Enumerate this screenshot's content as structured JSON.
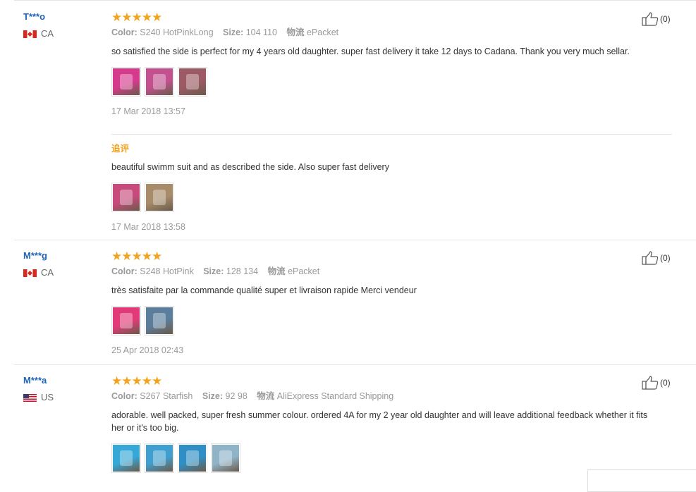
{
  "reviews": [
    {
      "user": "T***o",
      "country_code": "CA",
      "flag_icon": "canada-flag-icon",
      "rating": 5,
      "stars": "★★★★★",
      "color_label": "Color:",
      "color_value": "S240 HotPinkLong",
      "size_label": "Size:",
      "size_value": "104 110",
      "shipping_label": "物流",
      "shipping_value": "ePacket",
      "text": "so satisfied the side is perfect for my 4 years old daughter. super fast delivery it take 12 days to Cadana. Thank you very much sellar.",
      "thumbnails": [
        {
          "icon": "photo-thumbnail",
          "color": "#d63a8c"
        },
        {
          "icon": "photo-thumbnail",
          "color": "#c4508f"
        },
        {
          "icon": "photo-thumbnail",
          "color": "#9c5a64"
        }
      ],
      "date": "17 Mar 2018 13:57",
      "likes": "(0)",
      "followup": {
        "label": "追评",
        "text": "beautiful swimm suit and as described the side. Also super fast delivery",
        "thumbnails": [
          {
            "icon": "photo-thumbnail",
            "color": "#c84a7c"
          },
          {
            "icon": "photo-thumbnail",
            "color": "#a88c6a"
          }
        ],
        "date": "17 Mar 2018 13:58"
      }
    },
    {
      "user": "M***g",
      "country_code": "CA",
      "flag_icon": "canada-flag-icon",
      "rating": 5,
      "stars": "★★★★★",
      "color_label": "Color:",
      "color_value": "S248 HotPink",
      "size_label": "Size:",
      "size_value": "128 134",
      "shipping_label": "物流",
      "shipping_value": "ePacket",
      "text": "très satisfaite par la commande qualité super et livraison rapide Merci vendeur",
      "thumbnails": [
        {
          "icon": "photo-thumbnail",
          "color": "#e23a78"
        },
        {
          "icon": "photo-thumbnail",
          "color": "#5a7e9c"
        }
      ],
      "date": "25 Apr 2018 02:43",
      "likes": "(0)"
    },
    {
      "user": "M***a",
      "country_code": "US",
      "flag_icon": "us-flag-icon",
      "rating": 5,
      "stars": "★★★★★",
      "color_label": "Color:",
      "color_value": "S267 Starfish",
      "size_label": "Size:",
      "size_value": "92 98",
      "shipping_label": "物流",
      "shipping_value": "AliExpress Standard Shipping",
      "text": "adorable. well packed, super fresh summer colour. ordered 4A for my 2 year old daughter and will leave additional feedback whether it fits her or it's too big.",
      "thumbnails": [
        {
          "icon": "photo-thumbnail",
          "color": "#35a8d8"
        },
        {
          "icon": "photo-thumbnail",
          "color": "#3f9fd0"
        },
        {
          "icon": "photo-thumbnail",
          "color": "#2f8fc4"
        },
        {
          "icon": "photo-thumbnail",
          "color": "#8fb4c8"
        }
      ],
      "likes": "(0)"
    }
  ],
  "colors": {
    "star": "#f3a31c",
    "username": "#1f63b6",
    "followup_label": "#f3a31c",
    "meta_text": "#999999"
  }
}
